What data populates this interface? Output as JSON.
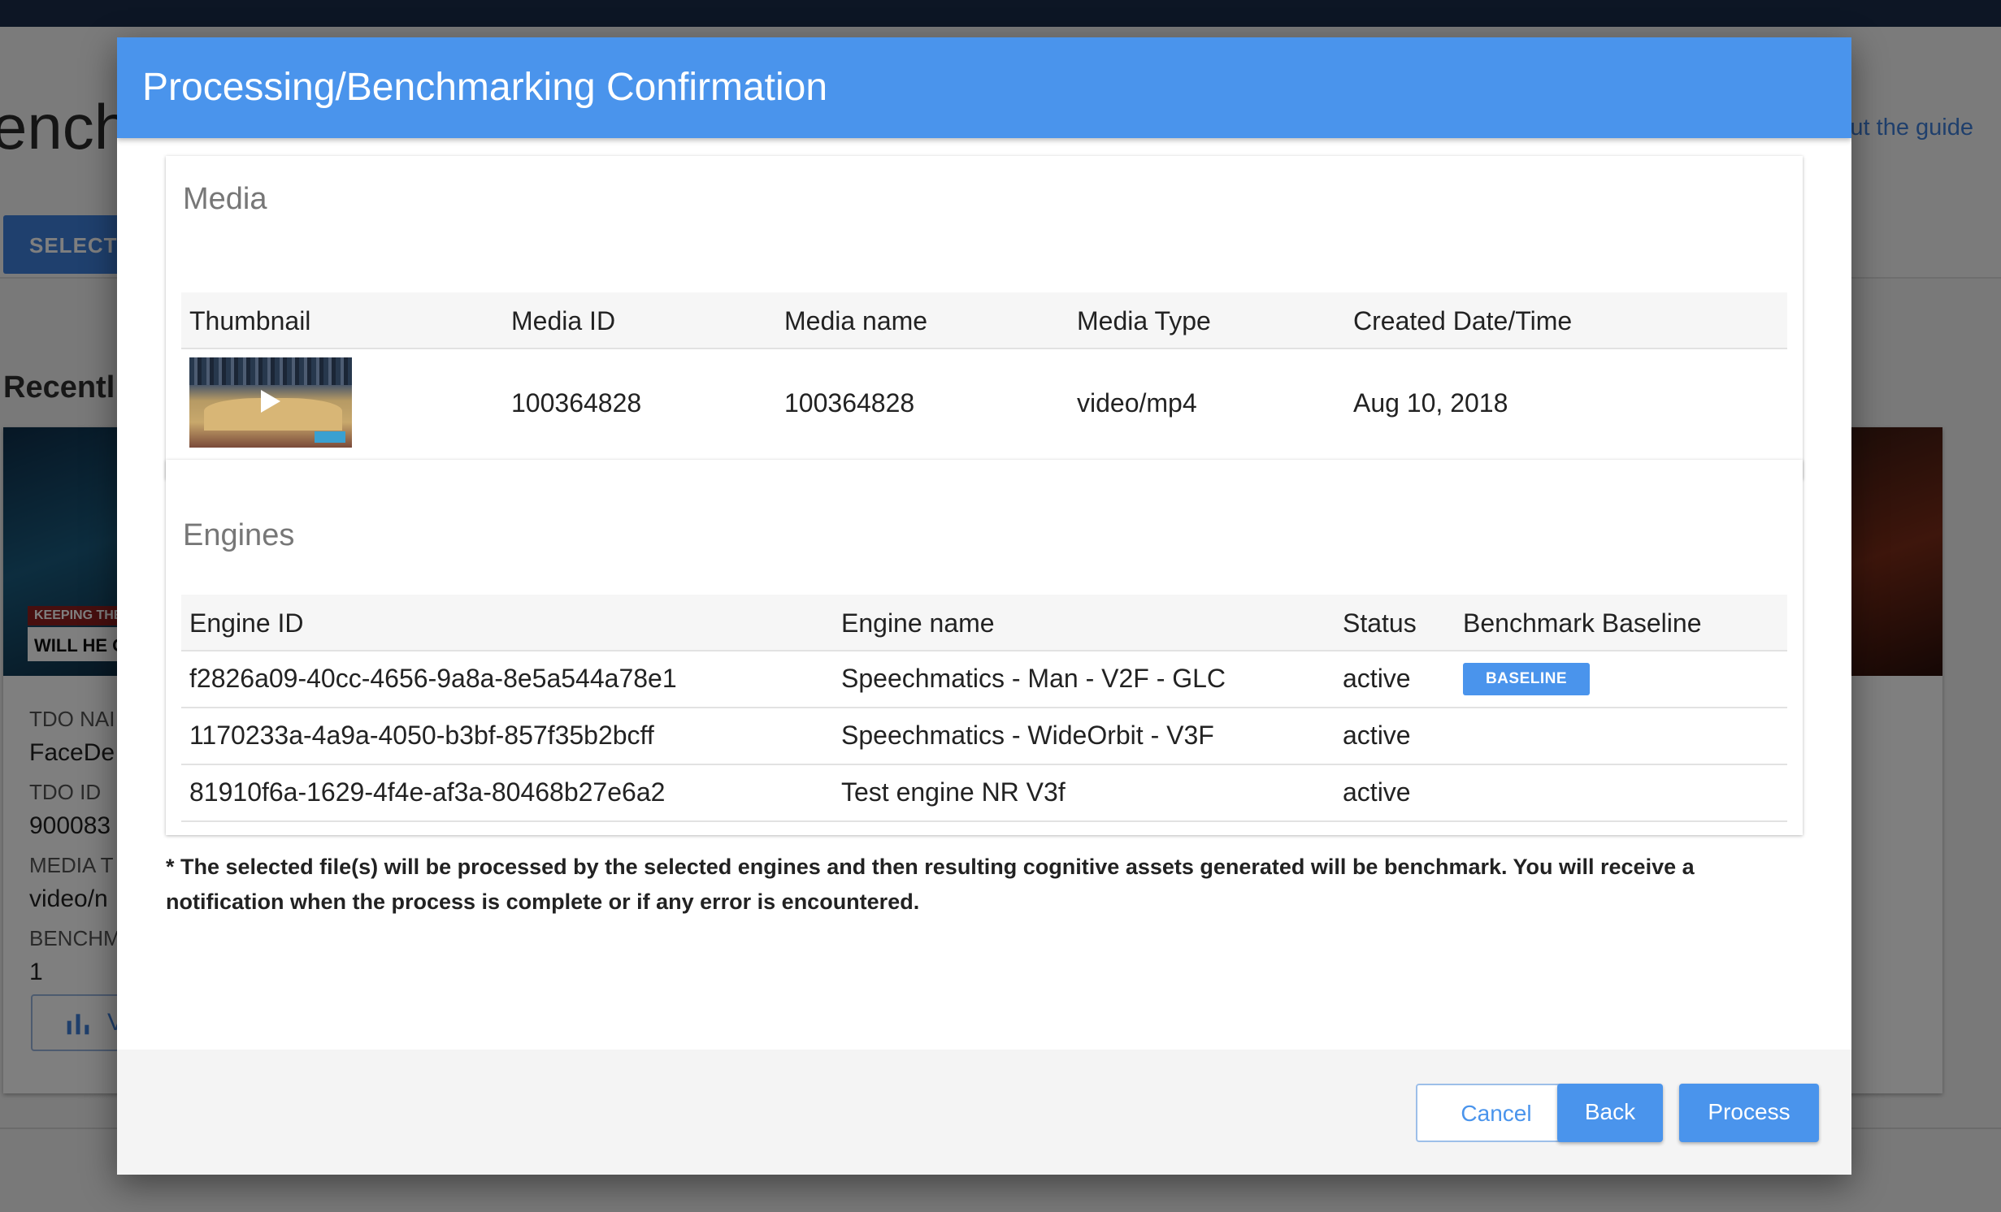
{
  "background": {
    "page_title": "ench",
    "guide_link": "ut the guide",
    "select_button": "SELECT",
    "recent_heading": "Recentl",
    "card": {
      "banner_top": "KEEPING THE",
      "banner_main": "WILL HE OR",
      "fields": [
        {
          "label": "TDO NAI",
          "value": "FaceDe"
        },
        {
          "label": "TDO ID",
          "value": "900083"
        },
        {
          "label": "MEDIA T",
          "value": "video/n"
        },
        {
          "label": "BENCHM",
          "value": "1"
        }
      ],
      "button_label": "V",
      "button_icon": "bar-chart-icon"
    }
  },
  "dialog": {
    "title": "Processing/Benchmarking Confirmation",
    "media_section": {
      "title": "Media",
      "columns": [
        "Thumbnail",
        "Media ID",
        "Media name",
        "Media Type",
        "Created Date/Time"
      ],
      "rows": [
        {
          "thumbnail_icon": "basketball-video-thumbnail",
          "media_id": "100364828",
          "media_name": "100364828",
          "media_type": "video/mp4",
          "created": "Aug 10, 2018"
        }
      ]
    },
    "engines_section": {
      "title": "Engines",
      "columns": [
        "Engine ID",
        "Engine name",
        "Status",
        "Benchmark Baseline"
      ],
      "rows": [
        {
          "engine_id": "f2826a09-40cc-4656-9a8a-8e5a544a78e1",
          "engine_name": "Speechmatics - Man - V2F - GLC",
          "status": "active",
          "baseline": "BASELINE"
        },
        {
          "engine_id": "1170233a-4a9a-4050-b3bf-857f35b2bcff",
          "engine_name": "Speechmatics - WideOrbit - V3F",
          "status": "active",
          "baseline": ""
        },
        {
          "engine_id": "81910f6a-1629-4f4e-af3a-80468b27e6a2",
          "engine_name": "Test engine NR V3f",
          "status": "active",
          "baseline": ""
        }
      ]
    },
    "note": "* The selected file(s) will be processed by the selected engines and then resulting cognitive assets generated will be benchmark. You will receive a notification when the process is complete or if any error is encountered.",
    "buttons": {
      "cancel": "Cancel",
      "back": "Back",
      "process": "Process"
    }
  },
  "colors": {
    "accent": "#4a94ec",
    "topbar": "#1b2c4a"
  }
}
